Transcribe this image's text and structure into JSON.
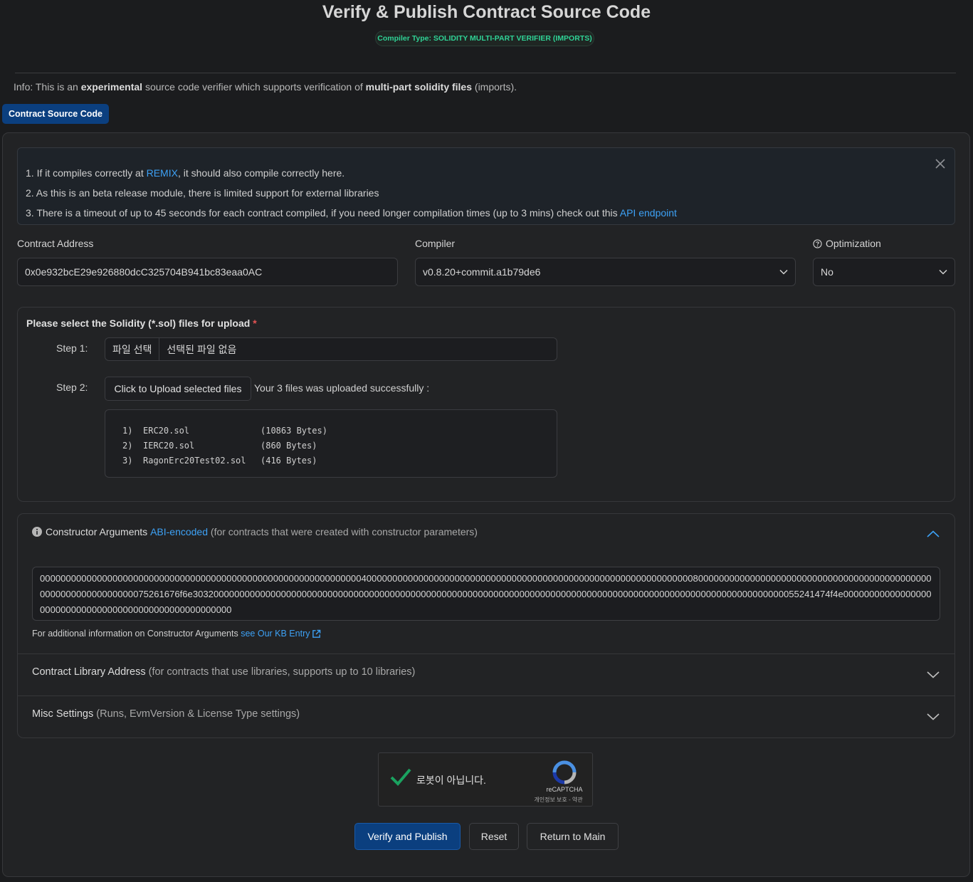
{
  "header": {
    "title": "Verify & Publish Contract Source Code",
    "compiler_type": "Compiler Type: SOLIDITY MULTI-PART VERIFIER (IMPORTS)"
  },
  "info": {
    "prefix": "Info: This is an ",
    "bold1": "experimental",
    "middle": " source code verifier which supports verification of ",
    "bold2": "multi-part solidity files",
    "suffix": " (imports)."
  },
  "tab": {
    "label": "Contract Source Code"
  },
  "notes": {
    "line1_prefix": "1. If it compiles correctly at ",
    "line1_link": "REMIX",
    "line1_suffix": ", it should also compile correctly here.",
    "line2": "2. As this is an beta release module, there is limited support for external libraries",
    "line3_prefix": "3. There is a timeout of up to 45 seconds for each contract compiled, if you need longer compilation times (up to 3 mins) check out this ",
    "line3_link": "API endpoint"
  },
  "form": {
    "address_label": "Contract Address",
    "address_value": "0x0e932bcE29e926880dcC325704B941bc83eaa0AC",
    "compiler_label": "Compiler",
    "compiler_value": "v0.8.20+commit.a1b79de6",
    "optimization_label": "Optimization",
    "optimization_value": "No"
  },
  "upload": {
    "title": "Please select the Solidity (*.sol) files for upload",
    "required_mark": "*",
    "step1_label": "Step 1:",
    "choose_file": "파일 선택",
    "no_file": "선택된 파일 없음",
    "step2_label": "Step 2:",
    "upload_button": "Click to Upload selected files",
    "success_message": "Your 3 files was uploaded successfully :",
    "files": [
      {
        "num": "1)",
        "name": "ERC20.sol",
        "size": "(10863 Bytes)"
      },
      {
        "num": "2)",
        "name": "IERC20.sol",
        "size": "(860 Bytes)"
      },
      {
        "num": "3)",
        "name": "RagonErc20Test02.sol",
        "size": "(416 Bytes)"
      }
    ]
  },
  "constructor": {
    "title": "Constructor Arguments",
    "link": "ABI-encoded",
    "subtitle": "(for contracts that were created with constructor parameters)",
    "value": "0000000000000000000000000000000000000000000000000000000000000040000000000000000000000000000000000000000000000000000000000000008000000000000000000000000000000000000000000000000000000000000000075261676f6e303200000000000000000000000000000000000000000000000000000000000000000000000000000000000000000000000000000000000000055241474f4e000000000000000000000000000000000000000000000000000000",
    "kb_prefix": "For additional information on Constructor Arguments ",
    "kb_link": "see Our KB Entry"
  },
  "library": {
    "title": "Contract Library Address",
    "subtitle": "(for contracts that use libraries, supports up to 10 libraries)"
  },
  "misc": {
    "title": "Misc Settings",
    "subtitle": "(Runs, EvmVersion & License Type settings)"
  },
  "captcha": {
    "label": "로봇이 아닙니다.",
    "brand": "reCAPTCHA",
    "terms": "개인정보 보호 - 약관"
  },
  "actions": {
    "verify": "Verify and Publish",
    "reset": "Reset",
    "return": "Return to Main"
  },
  "colors": {
    "accent": "#0b3f7f",
    "link": "#3da1f5",
    "badge_text": "#2fd396",
    "check": "#1aa260"
  }
}
